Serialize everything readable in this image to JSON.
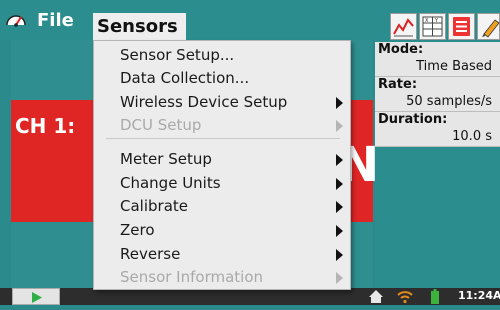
{
  "menubar": {
    "file_label": "File",
    "sensors_label": "Sensors"
  },
  "main": {
    "channel_label": "CH 1:",
    "meter_value_fragment": "N"
  },
  "side_panel": {
    "mode_title": "Mode:",
    "mode_value": "Time Based",
    "rate_title": "Rate:",
    "rate_value": "50 samples/s",
    "duration_title": "Duration:",
    "duration_value": "10.0 s"
  },
  "dropdown": {
    "items": [
      {
        "label": "Sensor Setup...",
        "submenu": false,
        "disabled": false
      },
      {
        "label": "Data Collection...",
        "submenu": false,
        "disabled": false
      },
      {
        "label": "Wireless Device Setup",
        "submenu": true,
        "disabled": false
      },
      {
        "label": "DCU Setup",
        "submenu": true,
        "disabled": true
      },
      {
        "label": "Meter Setup",
        "submenu": true,
        "disabled": false
      },
      {
        "label": "Change Units",
        "submenu": true,
        "disabled": false
      },
      {
        "label": "Calibrate",
        "submenu": true,
        "disabled": false
      },
      {
        "label": "Zero",
        "submenu": true,
        "disabled": false
      },
      {
        "label": "Reverse",
        "submenu": true,
        "disabled": false
      },
      {
        "label": "Sensor Information",
        "submenu": true,
        "disabled": true
      }
    ]
  },
  "statusbar": {
    "clock": "11:24A"
  },
  "colors": {
    "teal": "#2b8d8e",
    "meter_red": "#e02525",
    "menu_bg": "#ececec",
    "play_green": "#2fae4a"
  },
  "icons": {
    "app": "gauge-icon",
    "graph": "graph-icon",
    "table": "table-icon",
    "list": "list-icon",
    "pencil": "pencil-icon",
    "play": "play-icon",
    "home": "home-icon",
    "wifi": "wifi-icon",
    "battery": "battery-icon"
  }
}
